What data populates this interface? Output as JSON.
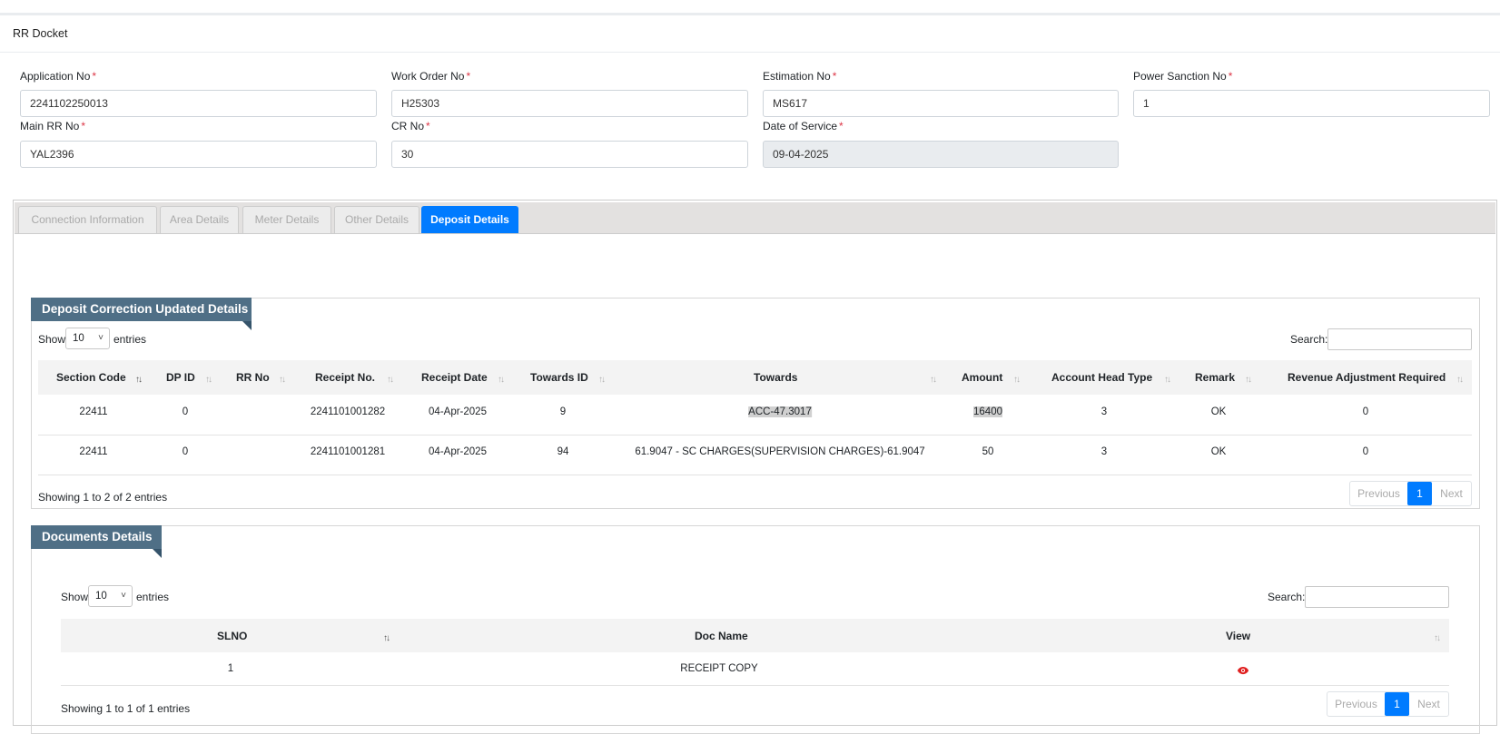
{
  "page": {
    "title": "RR Docket"
  },
  "form": {
    "application_no": {
      "label": "Application No",
      "value": "2241102250013"
    },
    "work_order_no": {
      "label": "Work Order No",
      "value": "H25303"
    },
    "estimation_no": {
      "label": "Estimation No",
      "value": "MS617"
    },
    "power_sanction_no": {
      "label": "Power Sanction No",
      "value": "1"
    },
    "main_rr_no": {
      "label": "Main RR No",
      "value": "YAL2396"
    },
    "cr_no": {
      "label": "CR No",
      "value": "30"
    },
    "date_of_service": {
      "label": "Date of Service",
      "value": "09-04-2025"
    },
    "required_mark": "*"
  },
  "tabs": [
    {
      "label": "Connection Information"
    },
    {
      "label": "Area Details"
    },
    {
      "label": "Meter Details"
    },
    {
      "label": "Other Details"
    },
    {
      "label": "Deposit Details"
    }
  ],
  "deposit": {
    "title": "Deposit Correction Updated Details",
    "show_label": "Show",
    "entries_value": "10",
    "entries_label": "entries",
    "search_label": "Search:",
    "columns": [
      "Section Code",
      "DP ID",
      "RR No",
      "Receipt No.",
      "Receipt Date",
      "Towards ID",
      "Towards",
      "Amount",
      "Account Head Type",
      "Remark",
      "Revenue Adjustment Required"
    ],
    "rows": [
      [
        "22411",
        "0",
        "",
        "2241101001282",
        "04-Apr-2025",
        "9",
        "ACC-47.3017",
        "16400",
        "3",
        "OK",
        "0"
      ],
      [
        "22411",
        "0",
        "",
        "2241101001281",
        "04-Apr-2025",
        "94",
        "61.9047 - SC CHARGES(SUPERVISION CHARGES)-61.9047",
        "50",
        "3",
        "OK",
        "0"
      ]
    ],
    "info": "Showing 1 to 2 of 2 entries",
    "pager": {
      "previous": "Previous",
      "current": "1",
      "next": "Next"
    }
  },
  "documents": {
    "title": "Documents Details",
    "show_label": "Show",
    "entries_value": "10",
    "entries_label": "entries",
    "search_label": "Search:",
    "columns": [
      "SLNO",
      "Doc Name",
      "View"
    ],
    "rows": [
      {
        "slno": "1",
        "doc_name": "RECEIPT COPY",
        "view_icon": "eye-icon"
      }
    ],
    "info": "Showing 1 to 1 of 1 entries",
    "pager": {
      "previous": "Previous",
      "current": "1",
      "next": "Next"
    }
  },
  "colors": {
    "accent": "#007bff",
    "ribbon": "#4f6f86",
    "required": "#dc3545",
    "eye": "#e02020"
  }
}
